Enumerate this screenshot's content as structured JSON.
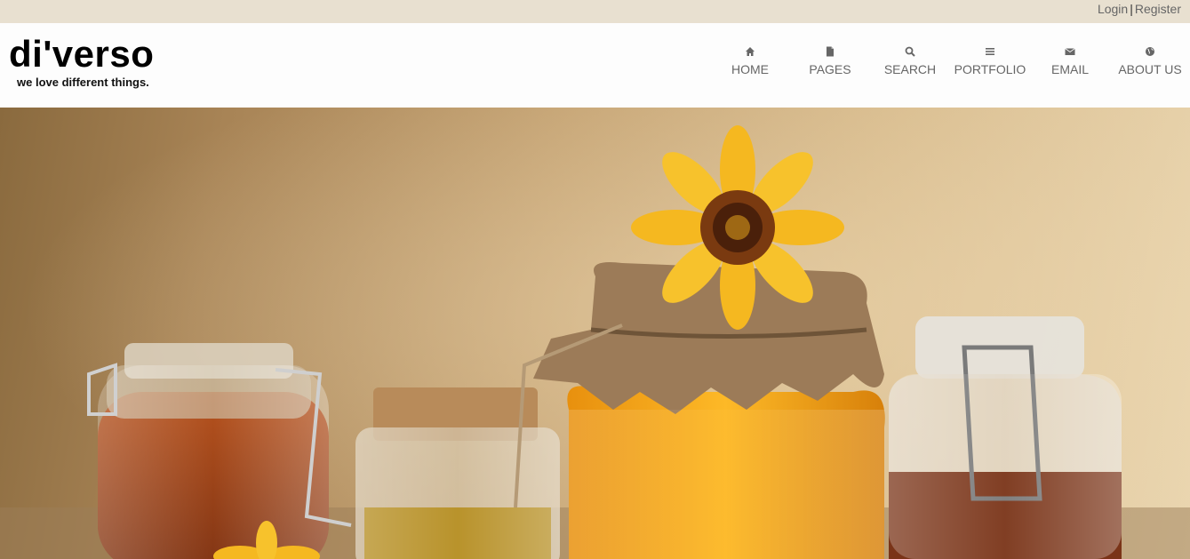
{
  "topbar": {
    "login_label": "Login",
    "separator": "|",
    "register_label": "Register"
  },
  "brand": {
    "logo": "di'verso",
    "tagline": "we love different things."
  },
  "nav": {
    "items": [
      {
        "label": "HOME",
        "icon": "home-icon"
      },
      {
        "label": "PAGES",
        "icon": "document-icon"
      },
      {
        "label": "SEARCH",
        "icon": "search-icon"
      },
      {
        "label": "PORTFOLIO",
        "icon": "list-icon"
      },
      {
        "label": "EMAIL",
        "icon": "envelope-icon"
      },
      {
        "label": "ABOUT US",
        "icon": "globe-icon"
      }
    ]
  },
  "colors": {
    "topbar": "#e8e0d0",
    "nav_text": "#666666",
    "honey": "#e8a020",
    "flower": "#f5b820"
  }
}
